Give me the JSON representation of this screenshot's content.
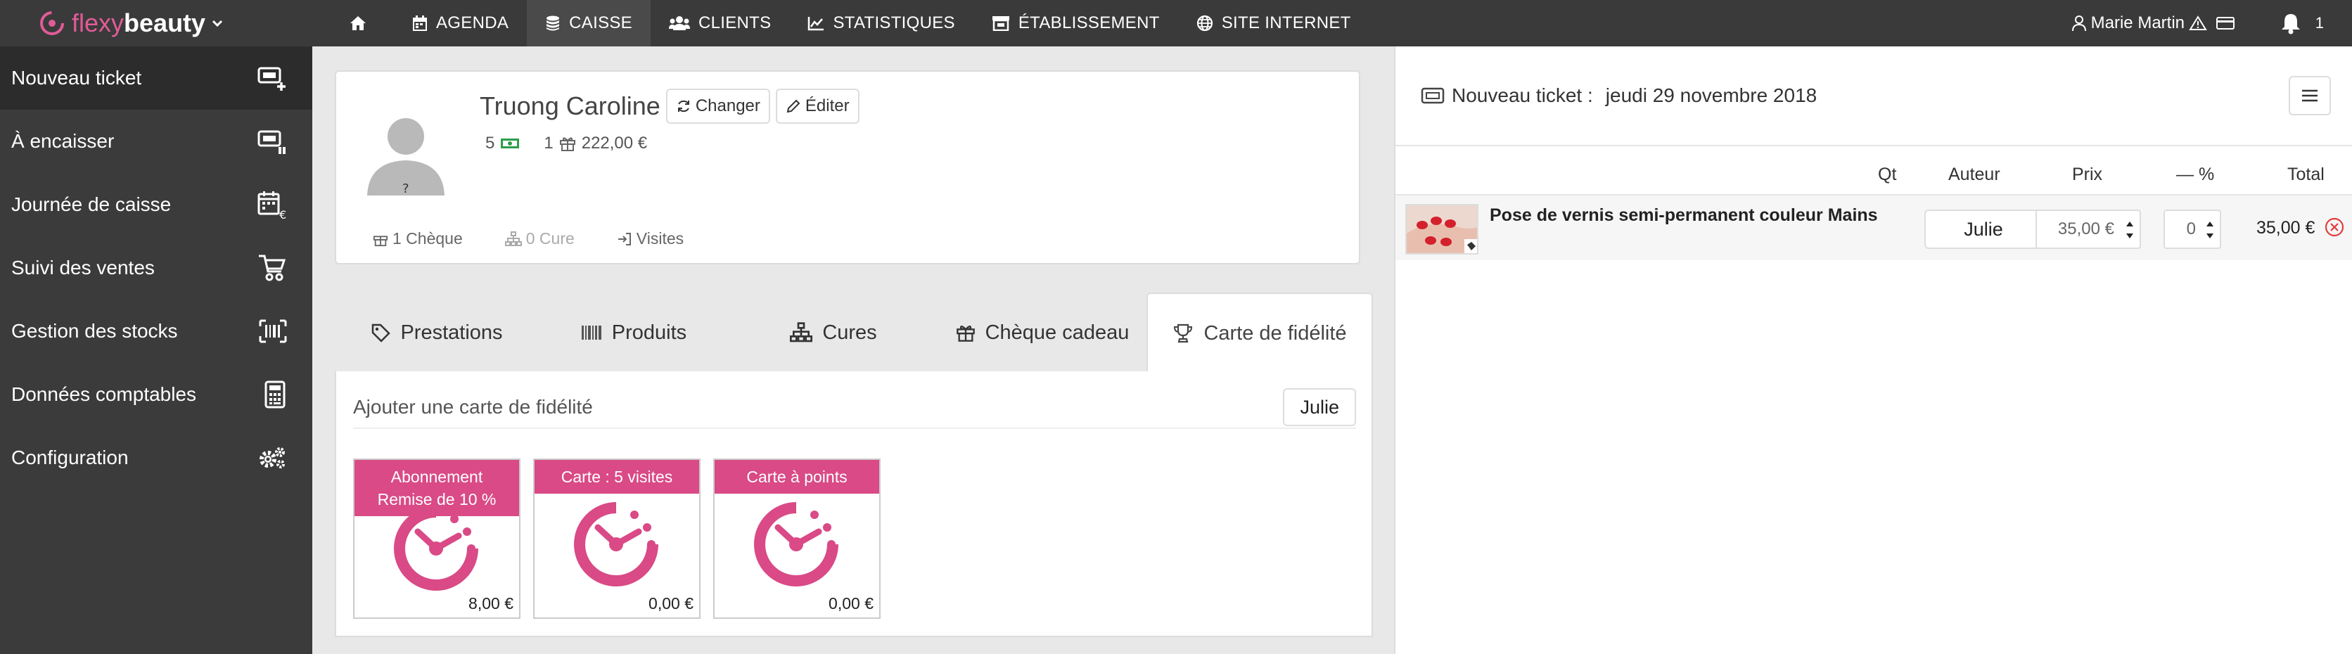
{
  "header": {
    "logo": {
      "part1": "flexy",
      "part2": "beauty"
    },
    "nav": [
      {
        "label": "",
        "icon": "home-icon"
      },
      {
        "label": "AGENDA",
        "icon": "calendar-icon"
      },
      {
        "label": "CAISSE",
        "icon": "coins-icon"
      },
      {
        "label": "CLIENTS",
        "icon": "users-icon"
      },
      {
        "label": "STATISTIQUES",
        "icon": "chart-icon"
      },
      {
        "label": "ÉTABLISSEMENT",
        "icon": "store-icon"
      },
      {
        "label": "SITE INTERNET",
        "icon": "globe-icon"
      }
    ],
    "active_nav": "CAISSE",
    "user_name": "Marie Martin",
    "notif_count": "1"
  },
  "sidebar": {
    "items": [
      {
        "label": "Nouveau ticket",
        "icon": "new-ticket-icon"
      },
      {
        "label": "À encaisser",
        "icon": "pending-ticket-icon"
      },
      {
        "label": "Journée de caisse",
        "icon": "calendar-euro-icon"
      },
      {
        "label": "Suivi des ventes",
        "icon": "cart-icon"
      },
      {
        "label": "Gestion des stocks",
        "icon": "barcode-icon"
      },
      {
        "label": "Données comptables",
        "icon": "calculator-icon"
      },
      {
        "label": "Configuration",
        "icon": "gears-icon"
      }
    ]
  },
  "client": {
    "name": "Truong Caroline",
    "change_label": "Changer",
    "edit_label": "Éditer",
    "avatar_mark": "?",
    "stats": {
      "cash_count": "5",
      "gift_count": "1",
      "gift_amount": "222,00 €"
    },
    "links": {
      "cheque": "1 Chèque",
      "cure": "0 Cure",
      "visites": "Visites"
    }
  },
  "tabs": [
    {
      "label": "Prestations",
      "icon": "tag-icon"
    },
    {
      "label": "Produits",
      "icon": "barcode-icon"
    },
    {
      "label": "Cures",
      "icon": "sitemap-icon"
    },
    {
      "label": "Chèque cadeau",
      "icon": "gift-icon"
    },
    {
      "label": "Carte de fidélité",
      "icon": "trophy-icon"
    }
  ],
  "panel": {
    "add_label": "Ajouter une carte de fidélité",
    "staff_button": "Julie",
    "cards": [
      {
        "line1": "Abonnement",
        "line2": "Remise de  10 %",
        "price": "8,00 €"
      },
      {
        "line1": "Carte : 5 visites",
        "line2": "",
        "price": "0,00 €"
      },
      {
        "line1": "Carte à points",
        "line2": "",
        "price": "0,00 €"
      }
    ]
  },
  "ticket": {
    "title": "Nouveau ticket :",
    "date": "jeudi 29 novembre 2018",
    "columns": {
      "qt": "Qt",
      "auteur": "Auteur",
      "prix": "Prix",
      "remise": "— %",
      "total": "Total"
    },
    "rows": [
      {
        "name": "Pose de vernis semi-permanent couleur Mains",
        "auteur": "Julie",
        "prix": "35,00 €",
        "remise": "0",
        "total": "35,00 €"
      }
    ]
  },
  "colors": {
    "brand": "#d94a86",
    "topbar": "#3a3a3a",
    "sidebar": "#3b3b3b",
    "remove": "#e23d3d"
  }
}
